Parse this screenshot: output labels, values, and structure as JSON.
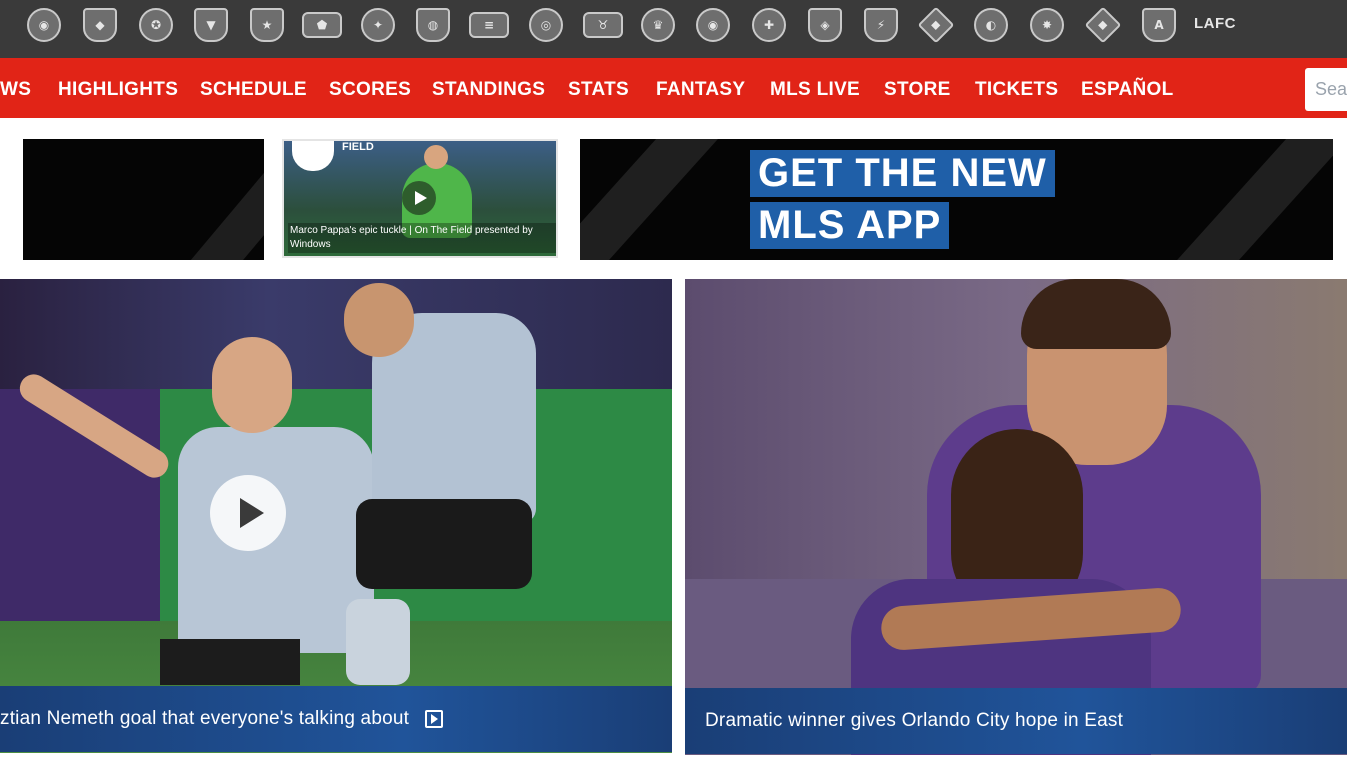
{
  "teambar": {
    "clubs": [
      {
        "icon": "colorado-crest-icon",
        "glyph": "◉"
      },
      {
        "icon": "colorado-rapids-crest-icon",
        "glyph": "◆"
      },
      {
        "icon": "columbus-crew-crest-icon",
        "glyph": "✪"
      },
      {
        "icon": "dc-united-crest-icon",
        "glyph": "▼"
      },
      {
        "icon": "fc-dallas-crest-icon",
        "glyph": "★"
      },
      {
        "icon": "houston-dynamo-crest-icon",
        "glyph": "⬟"
      },
      {
        "icon": "la-galaxy-crest-icon",
        "glyph": "✦"
      },
      {
        "icon": "montreal-impact-crest-icon",
        "glyph": "◍"
      },
      {
        "icon": "new-england-revolution-crest-icon",
        "glyph": "≡"
      },
      {
        "icon": "nycfc-crest-icon",
        "glyph": "◎"
      },
      {
        "icon": "ny-red-bulls-crest-icon",
        "glyph": "♉"
      },
      {
        "icon": "orlando-city-crest-icon",
        "glyph": "♛"
      },
      {
        "icon": "philadelphia-union-crest-icon",
        "glyph": "◉"
      },
      {
        "icon": "portland-timbers-crest-icon",
        "glyph": "✚"
      },
      {
        "icon": "real-salt-lake-crest-icon",
        "glyph": "◈"
      },
      {
        "icon": "san-jose-earthquakes-crest-icon",
        "glyph": "⚡"
      },
      {
        "icon": "seattle-sounders-crest-icon",
        "glyph": "◆"
      },
      {
        "icon": "sporting-kc-crest-icon",
        "glyph": "◐"
      },
      {
        "icon": "toronto-fc-crest-icon",
        "glyph": "✸"
      },
      {
        "icon": "vancouver-whitecaps-crest-icon",
        "glyph": "◆"
      },
      {
        "icon": "atlanta-united-crest-icon",
        "glyph": "A"
      }
    ],
    "last_club_label": "LAFC"
  },
  "nav": {
    "items": [
      "WS",
      "HIGHLIGHTS",
      "SCHEDULE",
      "SCORES",
      "STANDINGS",
      "STATS",
      "FANTASY",
      "MLS LIVE",
      "STORE",
      "TICKETS",
      "ESPAÑOL"
    ],
    "search_placeholder": "Sea"
  },
  "ads": {
    "thumb_brand": "FIELD",
    "thumb_caption": "Marco Pappa's epic tuckle | On The Field presented by Windows",
    "app_line1": "GET THE NEW",
    "app_line2": "MLS APP"
  },
  "stories": [
    {
      "caption": "ztian Nemeth goal that everyone's talking about",
      "has_video": true
    },
    {
      "caption": "Dramatic winner gives Orlando City hope in East",
      "has_video": false
    }
  ],
  "colors": {
    "teambar_bg": "#3a3a3a",
    "nav_red": "#e12417",
    "caption_blue": "#1a3e76",
    "app_blue": "#1f5fa8"
  }
}
